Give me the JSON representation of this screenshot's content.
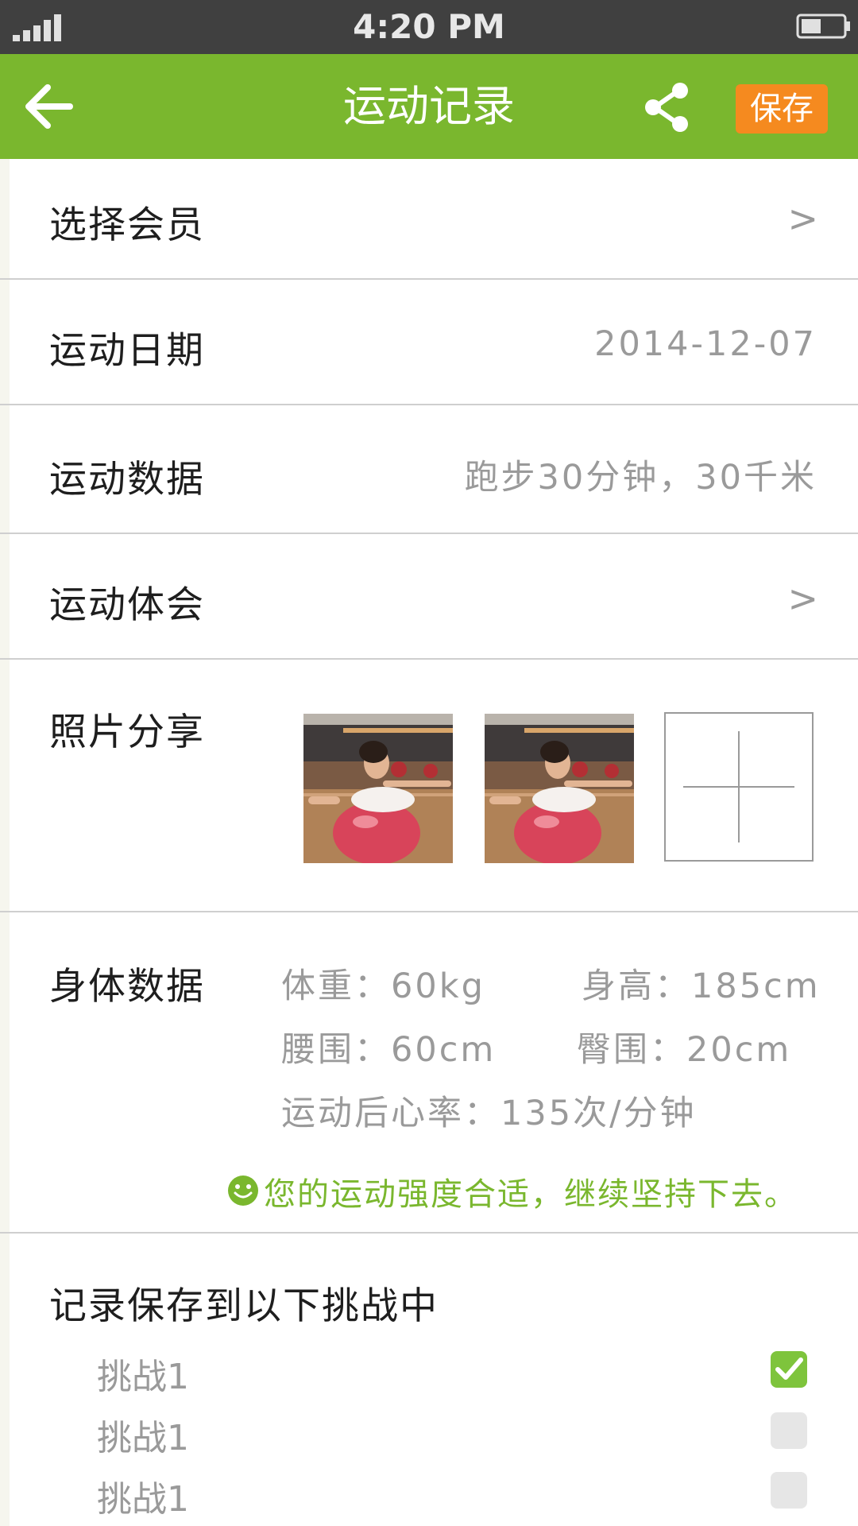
{
  "status_bar": {
    "time": "4:20 PM"
  },
  "nav": {
    "title": "运动记录",
    "save_label": "保存"
  },
  "rows": {
    "member": {
      "label": "选择会员",
      "chevron": ">"
    },
    "date": {
      "label": "运动日期",
      "value": "2014-12-07"
    },
    "exercise": {
      "label": "运动数据",
      "value": "跑步30分钟，30千米"
    },
    "experience": {
      "label": "运动体会",
      "chevron": ">"
    },
    "photos": {
      "label": "照片分享"
    }
  },
  "body": {
    "label": "身体数据",
    "weight": "体重：60kg",
    "height": "身高：185cm",
    "waist": "腰围：60cm",
    "hip": "臀围：20cm",
    "heart_rate": "运动后心率：135次/分钟",
    "tip": "您的运动强度合适，继续坚持下去。"
  },
  "challenges": {
    "title": "记录保存到以下挑战中",
    "items": [
      {
        "label": "挑战1",
        "checked": true
      },
      {
        "label": "挑战1",
        "checked": false
      },
      {
        "label": "挑战1",
        "checked": false
      }
    ]
  },
  "colors": {
    "brand_green": "#7ab72e",
    "save_orange": "#f58a1f",
    "status_bar": "#404040"
  }
}
